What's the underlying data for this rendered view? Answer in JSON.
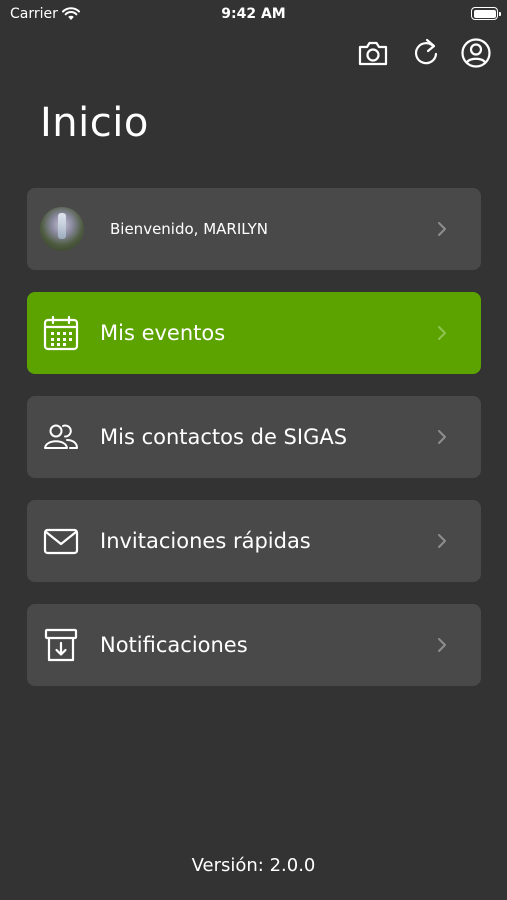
{
  "status_bar": {
    "carrier": "Carrier",
    "time": "9:42 AM"
  },
  "toolbar": {
    "icons": [
      "camera-icon",
      "refresh-icon",
      "user-circle-icon"
    ]
  },
  "page": {
    "title": "Inicio"
  },
  "menu": {
    "welcome": {
      "label": "Bienvenido, MARILYN"
    },
    "items": [
      {
        "label": "Mis eventos",
        "icon": "calendar-icon",
        "active": true
      },
      {
        "label": "Mis contactos de SIGAS",
        "icon": "users-icon",
        "active": false
      },
      {
        "label": "Invitaciones rápidas",
        "icon": "envelope-icon",
        "active": false
      },
      {
        "label": "Notificaciones",
        "icon": "archive-download-icon",
        "active": false
      }
    ]
  },
  "footer": {
    "version": "Versión: 2.0.0"
  },
  "colors": {
    "background": "#333333",
    "card": "#4a4949",
    "accent": "#5ca300"
  }
}
